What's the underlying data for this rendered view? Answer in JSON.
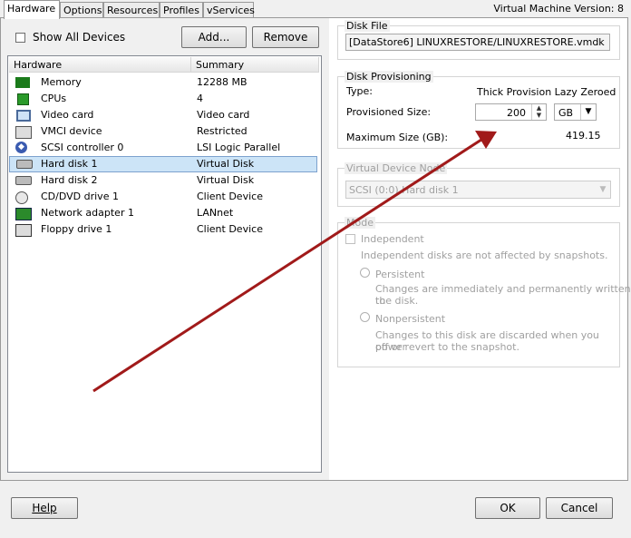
{
  "tabs": [
    "Hardware",
    "Options",
    "Resources",
    "Profiles",
    "vServices"
  ],
  "version_label": "Virtual Machine Version: 8",
  "show_all_devices_label": "Show All Devices",
  "add_button": "Add...",
  "remove_button": "Remove",
  "list": {
    "col_hardware": "Hardware",
    "col_summary": "Summary",
    "rows": [
      {
        "name": "Memory",
        "summary": "12288 MB",
        "icon": "memory-icon"
      },
      {
        "name": "CPUs",
        "summary": "4",
        "icon": "cpu-icon"
      },
      {
        "name": "Video card",
        "summary": "Video card",
        "icon": "monitor-icon"
      },
      {
        "name": "VMCI device",
        "summary": "Restricted",
        "icon": "vmci-icon"
      },
      {
        "name": "SCSI controller 0",
        "summary": "LSI Logic Parallel",
        "icon": "scsi-icon"
      },
      {
        "name": "Hard disk 1",
        "summary": "Virtual Disk",
        "icon": "harddisk-icon"
      },
      {
        "name": "Hard disk 2",
        "summary": "Virtual Disk",
        "icon": "harddisk-icon"
      },
      {
        "name": "CD/DVD drive 1",
        "summary": "Client Device",
        "icon": "cdrom-icon"
      },
      {
        "name": "Network adapter 1",
        "summary": "LANnet",
        "icon": "network-icon"
      },
      {
        "name": "Floppy drive 1",
        "summary": "Client Device",
        "icon": "floppy-icon"
      }
    ],
    "selected_index": 5
  },
  "disk_file": {
    "title": "Disk File",
    "path": "[DataStore6] LINUXRESTORE/LINUXRESTORE.vmdk"
  },
  "provisioning": {
    "title": "Disk Provisioning",
    "type_label": "Type:",
    "type_value": "Thick Provision Lazy Zeroed",
    "size_label": "Provisioned Size:",
    "size_value": "200",
    "unit": "GB",
    "max_label": "Maximum Size (GB):",
    "max_value": "419.15"
  },
  "device_node": {
    "title": "Virtual Device Node",
    "value": "SCSI (0:0) Hard disk 1"
  },
  "mode": {
    "title": "Mode",
    "independent_label": "Independent",
    "independent_desc": "Independent disks are not affected by snapshots.",
    "persistent_label": "Persistent",
    "persistent_desc_1": "Changes are immediately and permanently written to",
    "persistent_desc_2": "the disk.",
    "nonpersistent_label": "Nonpersistent",
    "nonpersistent_desc_1": "Changes to this disk are discarded when you power",
    "nonpersistent_desc_2": "off or revert to the snapshot."
  },
  "footer": {
    "help": "Help",
    "ok": "OK",
    "cancel": "Cancel"
  },
  "annotation_arrow_color": "#a11a1a"
}
